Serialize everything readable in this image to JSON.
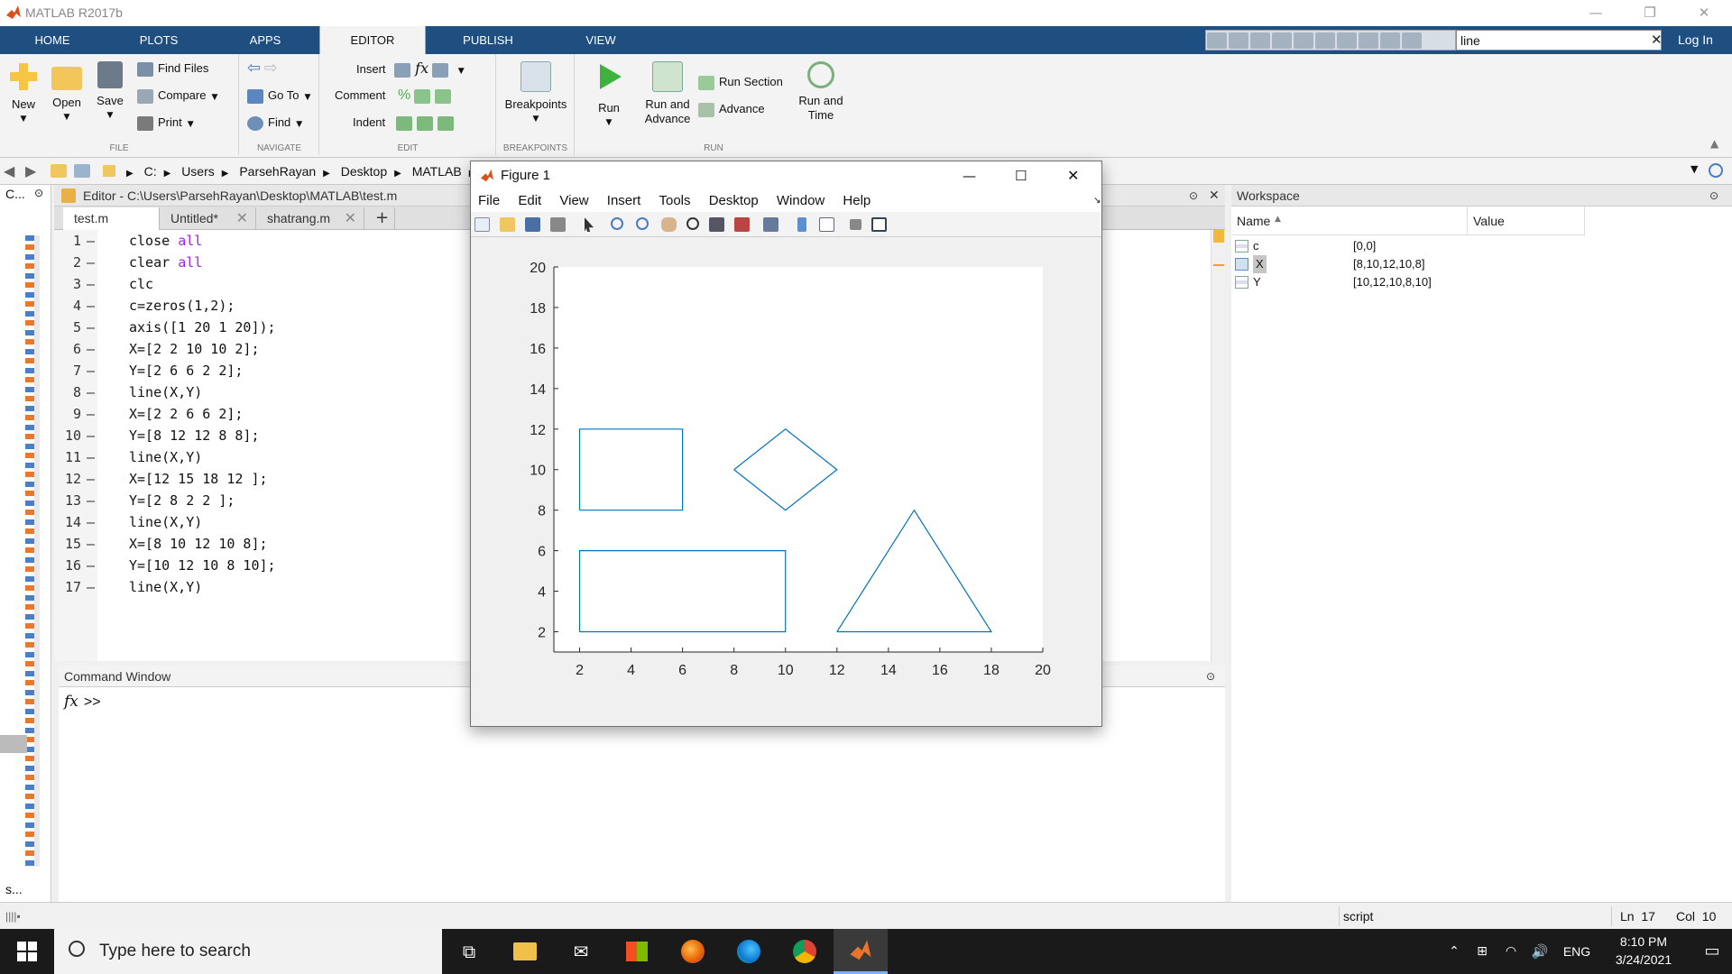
{
  "app": {
    "title": "MATLAB R2017b"
  },
  "ribbon_tabs": [
    "HOME",
    "PLOTS",
    "APPS",
    "EDITOR",
    "PUBLISH",
    "VIEW"
  ],
  "search": {
    "value": "line",
    "login": "Log In"
  },
  "ribbon": {
    "file": {
      "new": "New",
      "open": "Open",
      "save": "Save",
      "find_files": "Find Files",
      "compare": "Compare",
      "print": "Print",
      "label": "FILE"
    },
    "navigate": {
      "goto": "Go To",
      "find": "Find",
      "label": "NAVIGATE"
    },
    "edit": {
      "insert": "Insert",
      "comment": "Comment",
      "indent": "Indent",
      "fx": "fx",
      "label": "EDIT"
    },
    "breakpoints": {
      "button": "Breakpoints",
      "label": "BREAKPOINTS"
    },
    "run": {
      "run": "Run",
      "run_advance_1": "Run and",
      "run_advance_2": "Advance",
      "run_section": "Run Section",
      "advance": "Advance",
      "run_time_1": "Run and",
      "run_time_2": "Time",
      "label": "RUN"
    }
  },
  "address": {
    "crumbs": [
      "C:",
      "Users",
      "ParsehRayan",
      "Desktop",
      "MATLAB"
    ]
  },
  "left_panel": {
    "title": "C...",
    "bottom": "s..."
  },
  "editor": {
    "title": "Editor - C:\\Users\\ParsehRayan\\Desktop\\MATLAB\\test.m",
    "tabs": [
      "test.m",
      "Untitled*",
      "shatrang.m"
    ],
    "lines": [
      {
        "n": "1",
        "pre": "close ",
        "kw": "all"
      },
      {
        "n": "2",
        "pre": "clear ",
        "kw": "all"
      },
      {
        "n": "3",
        "pre": "clc",
        "kw": ""
      },
      {
        "n": "4",
        "pre": "c=zeros(1,2);",
        "kw": ""
      },
      {
        "n": "5",
        "pre": "axis([1 20 1 20]);",
        "kw": ""
      },
      {
        "n": "6",
        "pre": "X=[2 2 10 10 2];",
        "kw": ""
      },
      {
        "n": "7",
        "pre": "Y=[2 6 6 2 2];",
        "kw": ""
      },
      {
        "n": "8",
        "pre": "line(X,Y)",
        "kw": ""
      },
      {
        "n": "9",
        "pre": "X=[2 2 6 6 2];",
        "kw": ""
      },
      {
        "n": "10",
        "pre": "Y=[8 12 12 8 8];",
        "kw": ""
      },
      {
        "n": "11",
        "pre": "line(X,Y)",
        "kw": ""
      },
      {
        "n": "12",
        "pre": "X=[12 15 18 12 ];",
        "kw": ""
      },
      {
        "n": "13",
        "pre": "Y=[2 8 2 2 ];",
        "kw": ""
      },
      {
        "n": "14",
        "pre": "line(X,Y)",
        "kw": ""
      },
      {
        "n": "15",
        "pre": "X=[8 10 12 10 8];",
        "kw": ""
      },
      {
        "n": "16",
        "pre": "Y=[10 12 10 8 10];",
        "kw": ""
      },
      {
        "n": "17",
        "pre": "line(X,Y)",
        "kw": ""
      }
    ]
  },
  "command_window": {
    "title": "Command Window",
    "prompt": ">>",
    "fx": "fx"
  },
  "workspace": {
    "title": "Workspace",
    "columns": [
      "Name",
      "Value"
    ],
    "rows": [
      {
        "name": "c",
        "value": "[0,0]"
      },
      {
        "name": "X",
        "value": "[8,10,12,10,8]"
      },
      {
        "name": "Y",
        "value": "[10,12,10,8,10]"
      }
    ]
  },
  "status": {
    "type": "script",
    "ln_label": "Ln",
    "ln": "17",
    "col_label": "Col",
    "col": "10"
  },
  "figure": {
    "title": "Figure 1",
    "menu": [
      "File",
      "Edit",
      "View",
      "Insert",
      "Tools",
      "Desktop",
      "Window",
      "Help"
    ]
  },
  "chart_data": {
    "type": "line",
    "xlim": [
      1,
      20
    ],
    "ylim": [
      1,
      20
    ],
    "xticks": [
      2,
      4,
      6,
      8,
      10,
      12,
      14,
      16,
      18,
      20
    ],
    "yticks": [
      2,
      4,
      6,
      8,
      10,
      12,
      14,
      16,
      18,
      20
    ],
    "color": "#0072bd",
    "series": [
      {
        "x": [
          2,
          2,
          10,
          10,
          2
        ],
        "y": [
          2,
          6,
          6,
          2,
          2
        ]
      },
      {
        "x": [
          2,
          2,
          6,
          6,
          2
        ],
        "y": [
          8,
          12,
          12,
          8,
          8
        ]
      },
      {
        "x": [
          12,
          15,
          18,
          12
        ],
        "y": [
          2,
          8,
          2,
          2
        ]
      },
      {
        "x": [
          8,
          10,
          12,
          10,
          8
        ],
        "y": [
          10,
          12,
          10,
          8,
          10
        ]
      }
    ]
  },
  "taskbar": {
    "search_placeholder": "Type here to search",
    "lang": "ENG",
    "time": "8:10 PM",
    "date": "3/24/2021"
  },
  "colors": {
    "ribbon_tab_bg": "#1f4e80",
    "keyword": "#a020f0",
    "plot_line": "#0072bd"
  }
}
